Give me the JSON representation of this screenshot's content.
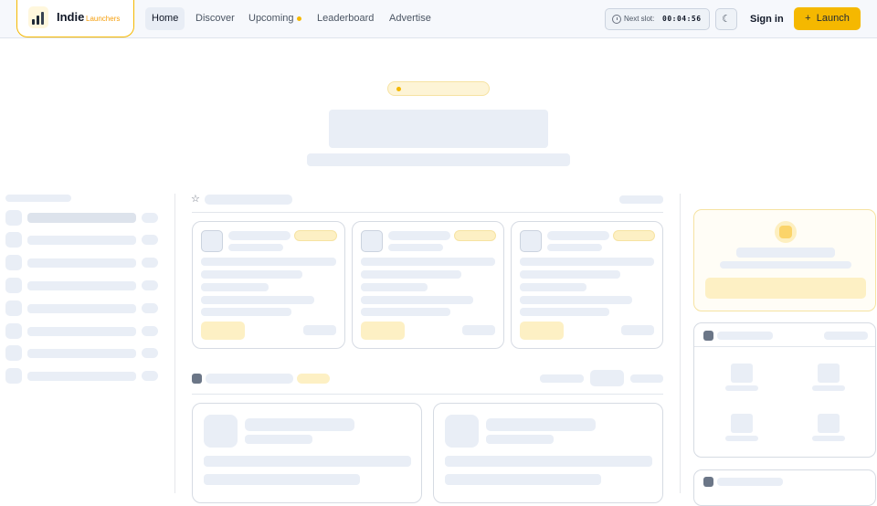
{
  "brand": {
    "name": "Indie",
    "sub": "Launchers"
  },
  "nav": [
    {
      "label": "Home",
      "active": true
    },
    {
      "label": "Discover"
    },
    {
      "label": "Upcoming",
      "dot": true
    },
    {
      "label": "Leaderboard"
    },
    {
      "label": "Advertise"
    }
  ],
  "slot": {
    "label": "Next slot:",
    "time": "00:04:56"
  },
  "auth": {
    "signin": "Sign in",
    "launch": "Launch",
    "launch_icon": "+"
  },
  "colors": {
    "accent": "#f5b800",
    "skeleton": "#e9eef6",
    "skeleton_accent": "#fdf0c4"
  }
}
